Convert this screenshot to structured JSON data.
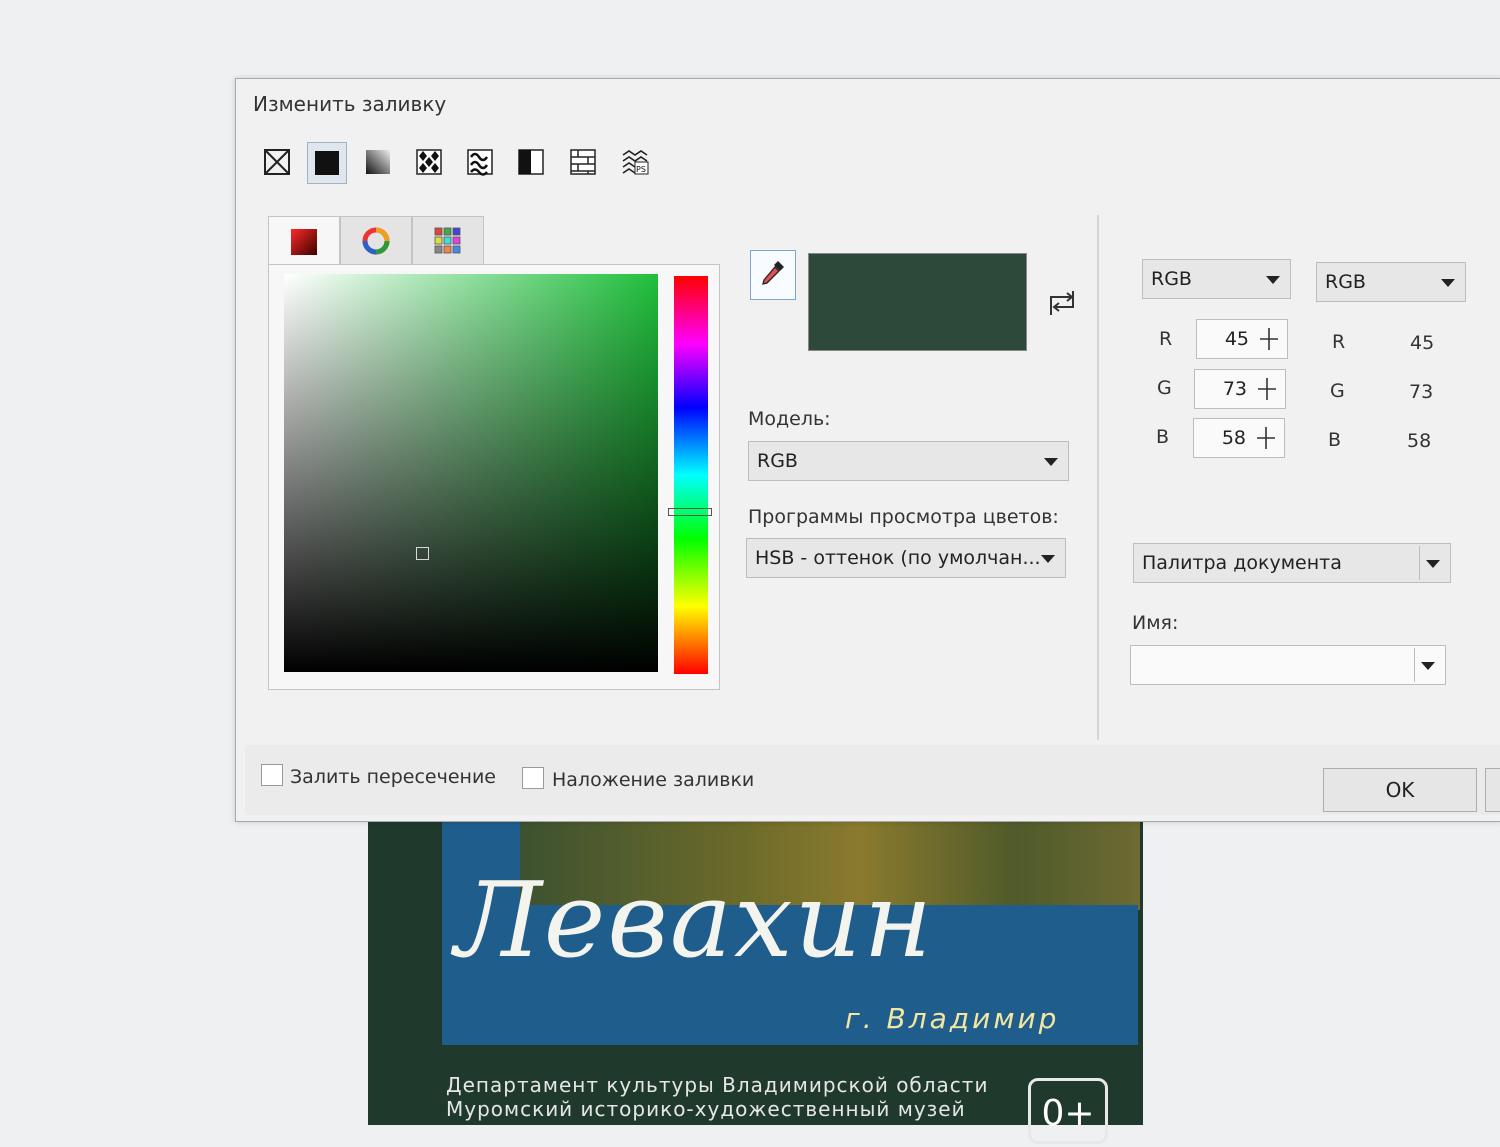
{
  "dialog": {
    "title": "Изменить заливку",
    "fill_types": [
      {
        "icon": "no-fill-icon"
      },
      {
        "icon": "uniform-fill-icon"
      },
      {
        "icon": "fountain-fill-icon"
      },
      {
        "icon": "vector-pattern-fill-icon"
      },
      {
        "icon": "bitmap-pattern-fill-icon"
      },
      {
        "icon": "two-color-pattern-fill-icon"
      },
      {
        "icon": "texture-fill-icon"
      },
      {
        "icon": "postscript-fill-icon"
      }
    ],
    "tabs": [
      {
        "icon": "color-model-icon"
      },
      {
        "icon": "color-harmonies-icon"
      },
      {
        "icon": "color-palettes-icon"
      }
    ],
    "current_color": "#2D493A",
    "model_label": "Модель:",
    "model_value": "RGB",
    "viewer_label": "Программы просмотра цветов:",
    "viewer_value": "HSB - оттенок (по умолчан...",
    "left_model_select": "RGB",
    "right_model_select": "RGB",
    "channels": [
      {
        "letter": "R",
        "value": "45",
        "readout_letter": "R",
        "readout": "45"
      },
      {
        "letter": "G",
        "value": "73",
        "readout_letter": "G",
        "readout": "73"
      },
      {
        "letter": "B",
        "value": "58",
        "readout_letter": "B",
        "readout": "58"
      }
    ],
    "palette_select": "Палитра документа",
    "name_label": "Имя:",
    "name_value": "",
    "checkbox_intersect": "Залить пересечение",
    "checkbox_overprint": "Наложение заливки",
    "ok_label": "OK"
  },
  "poster": {
    "name": "Левахин",
    "city": "г. Владимир",
    "line1": "Департамент культуры Владимирской области",
    "line2": "Муромский историко-художественный музей",
    "age_rating": "0+"
  }
}
